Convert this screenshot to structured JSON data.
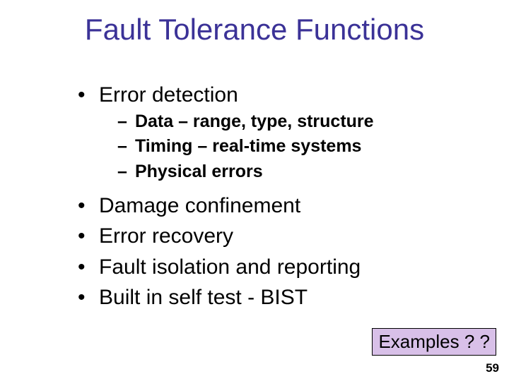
{
  "title": "Fault Tolerance Functions",
  "bullets": {
    "b1": "Error detection",
    "b1_subs": {
      "s1": "Data – range, type, structure",
      "s2": "Timing – real-time systems",
      "s3": "Physical errors"
    },
    "b2": "Damage confinement",
    "b3": "Error recovery",
    "b4": "Fault isolation and reporting",
    "b5": "Built in self test - BIST"
  },
  "callout": "Examples ? ?",
  "page_number": "59"
}
